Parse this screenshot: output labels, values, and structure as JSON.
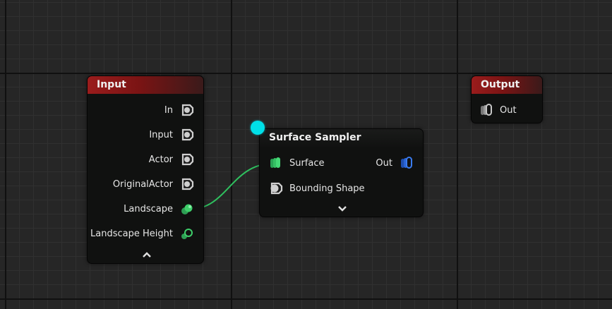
{
  "graph": {
    "input_node": {
      "title": "Input",
      "pins": [
        {
          "label": "In",
          "type": "generic"
        },
        {
          "label": "Input",
          "type": "generic"
        },
        {
          "label": "Actor",
          "type": "generic"
        },
        {
          "label": "OriginalActor",
          "type": "generic"
        },
        {
          "label": "Landscape",
          "type": "landscape-connected"
        },
        {
          "label": "Landscape Height",
          "type": "landscape-height"
        }
      ],
      "collapse_icon": "chevron-up-icon"
    },
    "surface_sampler_node": {
      "title": "Surface Sampler",
      "inputs": [
        {
          "label": "Surface",
          "type": "surface"
        },
        {
          "label": "Bounding Shape",
          "type": "spatial"
        }
      ],
      "outputs": [
        {
          "label": "Out",
          "type": "point"
        }
      ],
      "expand_icon": "chevron-down-icon"
    },
    "output_node": {
      "title": "Output",
      "inputs": [
        {
          "label": "Out",
          "type": "any"
        }
      ]
    }
  },
  "colors": {
    "input_header": "#9a1c1c",
    "landscape_pin": "#3ecf6a",
    "point_pin": "#2f6fe0",
    "exec_dot": "#00e0e8",
    "wire": "#2fc05f"
  }
}
